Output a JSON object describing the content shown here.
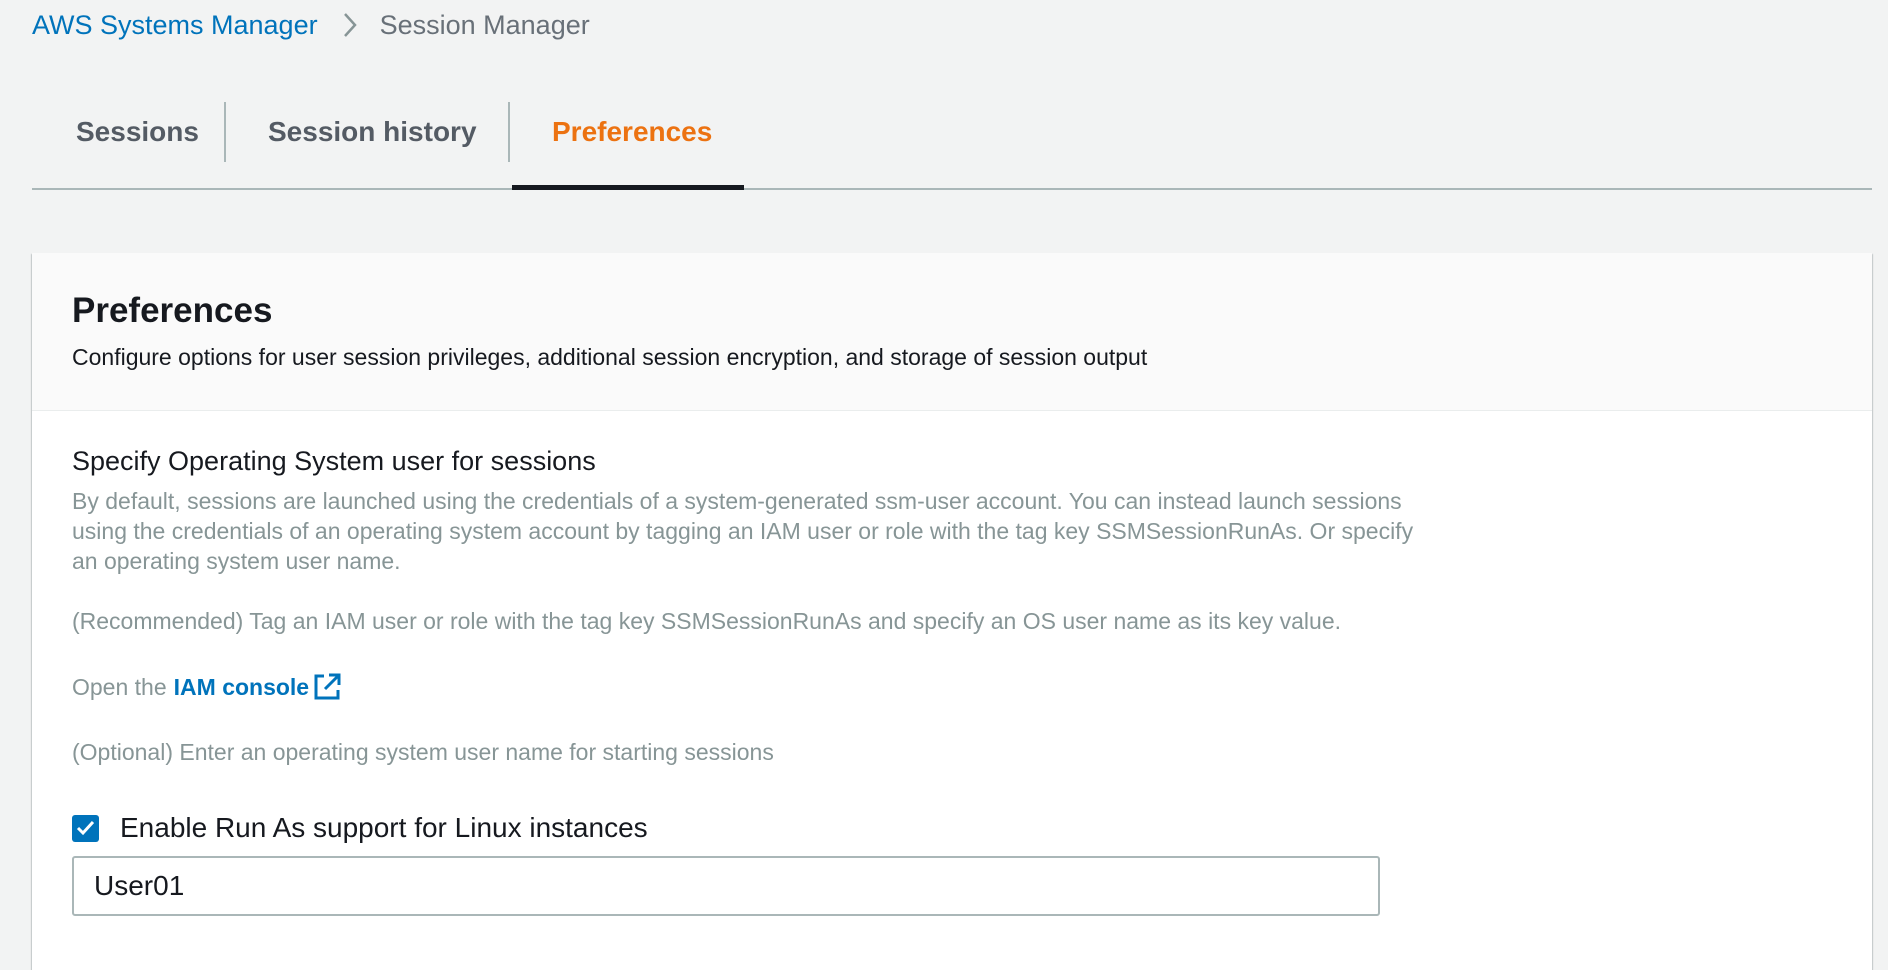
{
  "breadcrumb": {
    "parent": "AWS Systems Manager",
    "current": "Session Manager"
  },
  "tabs": [
    {
      "label": "Sessions",
      "active": false
    },
    {
      "label": "Session history",
      "active": false
    },
    {
      "label": "Preferences",
      "active": true
    }
  ],
  "panel": {
    "title": "Preferences",
    "description": "Configure options for user session privileges, additional session encryption, and storage of session output"
  },
  "run_as": {
    "title": "Specify Operating System user for sessions",
    "description": "By default, sessions are launched using the credentials of a system-generated ssm-user account. You can instead launch sessions using the credentials of an operating system account by tagging an IAM user or role with the tag key SSMSessionRunAs. Or specify an operating system user name.",
    "recommended": "(Recommended) Tag an IAM user or role with the tag key SSMSessionRunAs and specify an OS user name as its key value.",
    "iam_prefix": "Open the",
    "iam_link": "IAM console",
    "optional": "(Optional) Enter an operating system user name for starting sessions",
    "checkbox_label": "Enable Run As support for Linux instances",
    "checkbox_checked": true,
    "user_name_value": "User01"
  },
  "colors": {
    "link": "#0073bb",
    "active_tab": "#ec7211",
    "checkbox": "#0073bb",
    "help_text": "#879596"
  },
  "icons": {
    "breadcrumb_separator": "chevron-right-icon",
    "external_link": "external-link-icon",
    "checkbox": "checkmark-icon"
  }
}
